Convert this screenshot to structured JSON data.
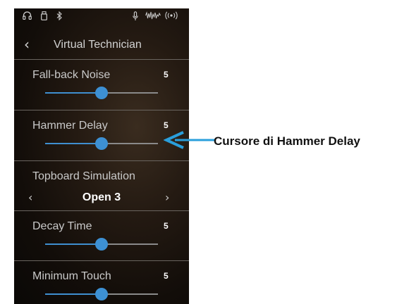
{
  "status_bar": {
    "icons": [
      "headphones-icon",
      "usb-icon",
      "bluetooth-icon",
      "microphone-icon",
      "waveform-icon",
      "wireless-icon"
    ]
  },
  "header": {
    "back_icon": "‹",
    "title": "Virtual Technician"
  },
  "settings": [
    {
      "label": "Fall-back Noise",
      "value": "5",
      "level": 0.5
    },
    {
      "label": "Hammer Delay",
      "value": "5",
      "level": 0.5
    },
    {
      "label": "Decay Time",
      "value": "5",
      "level": 0.5
    },
    {
      "label": "Minimum Touch",
      "value": "5",
      "level": 0.5
    }
  ],
  "topboard": {
    "label": "Topboard Simulation",
    "value": "Open 3",
    "prev_icon": "‹",
    "next_icon": "›"
  },
  "callout": {
    "text": "Cursore di Hammer Delay"
  },
  "colors": {
    "accent": "#3d90d3",
    "text": "#c9c9c9",
    "value": "#ffffff"
  }
}
